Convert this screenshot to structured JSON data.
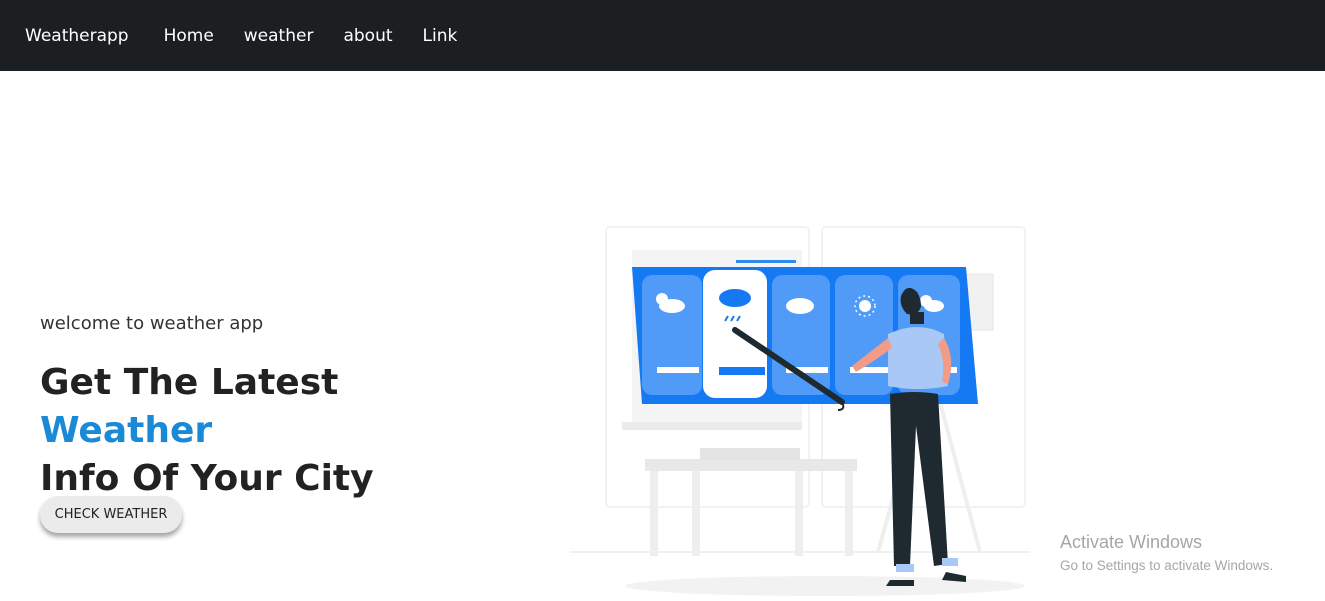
{
  "navbar": {
    "brand": "Weatherapp",
    "links": [
      "Home",
      "weather",
      "about",
      "Link"
    ]
  },
  "hero": {
    "welcome": "welcome to weather app",
    "headline_part1": "Get The Latest ",
    "headline_accent": "Weather",
    "headline_part2": "Info Of Your City",
    "button_label": "CHECK WEATHER"
  },
  "watermark": {
    "title": "Activate Windows",
    "subtitle": "Go to Settings to activate Windows."
  },
  "colors": {
    "navbar_bg": "#1c1f22",
    "accent": "#1a8ad6",
    "panel_blue": "#1479f2"
  }
}
